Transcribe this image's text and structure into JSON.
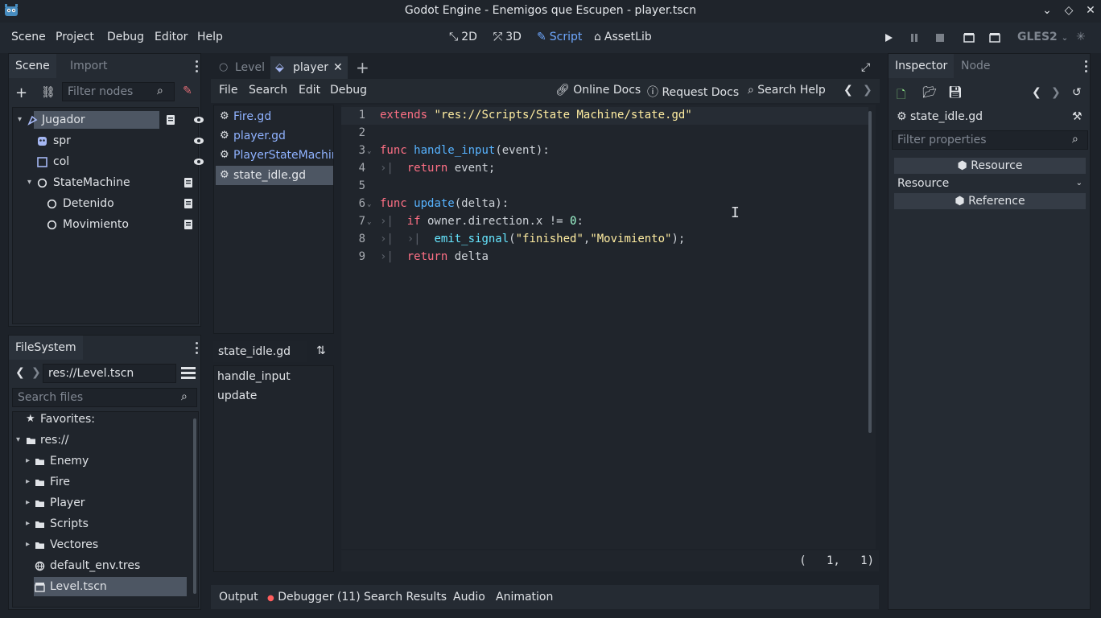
{
  "window": {
    "title": "Godot Engine - Enemigos que Escupen - player.tscn"
  },
  "menubar": {
    "menus": [
      "Scene",
      "Project",
      "Debug",
      "Editor",
      "Help"
    ],
    "workspaces": [
      {
        "label": "2D",
        "active": false
      },
      {
        "label": "3D",
        "active": false
      },
      {
        "label": "Script",
        "active": true
      },
      {
        "label": "AssetLib",
        "active": false
      }
    ],
    "renderer": "GLES2"
  },
  "scene_dock": {
    "tabs": [
      "Scene",
      "Import"
    ],
    "filter_placeholder": "Filter nodes",
    "nodes": [
      {
        "label": "Jugador",
        "icon": "kinematic-body-icon",
        "depth": 0,
        "expanded": true,
        "selected": true,
        "script": true,
        "visible": true
      },
      {
        "label": "spr",
        "icon": "sprite-icon",
        "depth": 1,
        "visible": true
      },
      {
        "label": "col",
        "icon": "collision-shape-icon",
        "depth": 1,
        "visible": true
      },
      {
        "label": "StateMachine",
        "icon": "node-icon",
        "depth": 1,
        "expanded": true,
        "script": true
      },
      {
        "label": "Detenido",
        "icon": "node-icon",
        "depth": 2,
        "script": true
      },
      {
        "label": "Movimiento",
        "icon": "node-icon",
        "depth": 2,
        "script": true
      }
    ]
  },
  "filesystem_dock": {
    "tab": "FileSystem",
    "path": "res://Level.tscn",
    "search_placeholder": "Search files",
    "items": [
      {
        "label": "Favorites:",
        "icon": "star-icon",
        "depth": 0
      },
      {
        "label": "res://",
        "icon": "folder-icon",
        "depth": 0,
        "expanded": true
      },
      {
        "label": "Enemy",
        "icon": "folder-icon",
        "depth": 1
      },
      {
        "label": "Fire",
        "icon": "folder-icon",
        "depth": 1
      },
      {
        "label": "Player",
        "icon": "folder-icon",
        "depth": 1
      },
      {
        "label": "Scripts",
        "icon": "folder-icon",
        "depth": 1
      },
      {
        "label": "Vectores",
        "icon": "folder-icon",
        "depth": 1
      },
      {
        "label": "default_env.tres",
        "icon": "environment-icon",
        "depth": 1
      },
      {
        "label": "Level.tscn",
        "icon": "scene-icon",
        "depth": 1,
        "selected": true
      }
    ]
  },
  "editor_tabs": [
    {
      "label": "Level",
      "active": false
    },
    {
      "label": "player",
      "active": true
    }
  ],
  "script_menu": {
    "items": [
      "File",
      "Search",
      "Edit",
      "Debug"
    ],
    "right": [
      "Online Docs",
      "Request Docs",
      "Search Help"
    ]
  },
  "script_list": [
    {
      "label": "Fire.gd",
      "selected": false
    },
    {
      "label": "player.gd",
      "selected": false
    },
    {
      "label": "PlayerStateMachine",
      "selected": false
    },
    {
      "label": "state_idle.gd",
      "selected": true
    }
  ],
  "method_panel": {
    "filename": "state_idle.gd",
    "methods": [
      "handle_input",
      "update"
    ]
  },
  "code": {
    "line_numbers": [
      "1",
      "2",
      "3",
      "4",
      "5",
      "6",
      "7",
      "8",
      "9"
    ],
    "cursor": {
      "line": 1,
      "col": 1
    },
    "cursor_label": "(   1,   1)"
  },
  "bottom_tabs": [
    "Output",
    "Debugger (11)",
    "Search Results",
    "Audio",
    "Animation"
  ],
  "inspector": {
    "tabs": [
      "Inspector",
      "Node"
    ],
    "file": "state_idle.gd",
    "filter_placeholder": "Filter properties",
    "sections": [
      "Resource",
      "Resource",
      "Reference"
    ]
  },
  "colors": {
    "accent": "#6fa8ff",
    "keyword": "#ff7085",
    "function": "#66e6ff",
    "string": "#ffeda1",
    "number": "#a3ffd4"
  }
}
